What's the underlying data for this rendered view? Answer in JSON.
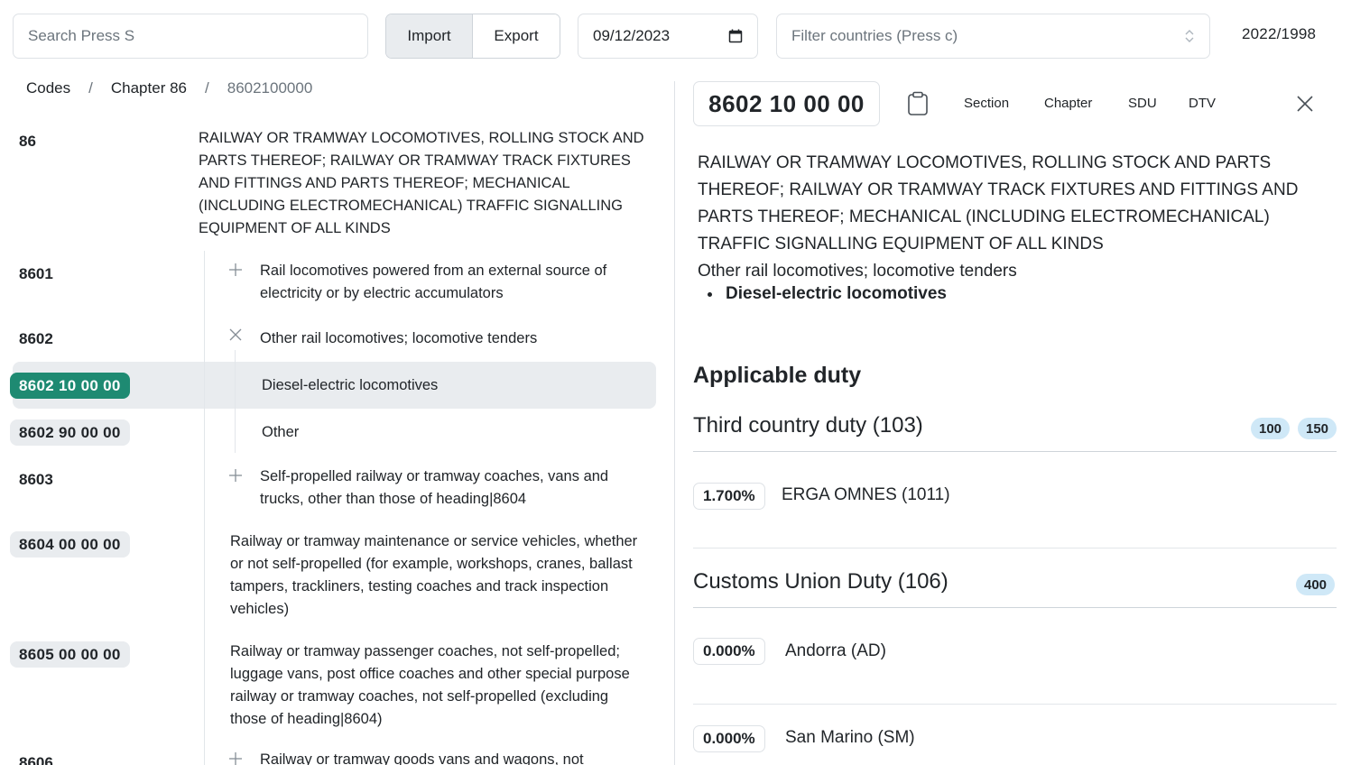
{
  "topbar": {
    "search_placeholder": "Search Press S",
    "import_label": "Import",
    "export_label": "Export",
    "date_value": "09/12/2023",
    "country_placeholder": "Filter countries (Press c)",
    "regulation": "2022/1998"
  },
  "breadcrumb": {
    "items": [
      "Codes",
      "Chapter 86",
      "8602100000"
    ],
    "separator": "/"
  },
  "tree": {
    "rows": [
      {
        "code": "86",
        "description": "RAILWAY OR TRAMWAY LOCOMOTIVES, ROLLING STOCK AND PARTS THEREOF; RAILWAY OR TRAMWAY TRACK FIXTURES AND FITTINGS AND PARTS THEREOF; MECHANICAL (INCLUDING ELECTROMECHANICAL) TRAFFIC SIGNALLING EQUIPMENT OF ALL KINDS"
      },
      {
        "code": "8601",
        "description": "Rail locomotives powered from an external source of electricity or by electric accumulators",
        "toggle": "expand"
      },
      {
        "code": "8602",
        "description": "Other rail locomotives; locomotive tenders",
        "toggle": "collapse"
      },
      {
        "code": "8602 10 00 00",
        "description": "Diesel-electric locomotives",
        "selected": true
      },
      {
        "code": "8602 90 00 00",
        "description": "Other"
      },
      {
        "code": "8603",
        "description": "Self-propelled railway or tramway coaches, vans and trucks, other than those of heading|8604",
        "toggle": "expand"
      },
      {
        "code": "8604 00 00 00",
        "description": "Railway or tramway maintenance or service vehicles, whether or not self-propelled (for example, workshops, cranes, ballast tampers, trackliners, testing coaches and track inspection vehicles)"
      },
      {
        "code": "8605 00 00 00",
        "description": "Railway or tramway passenger coaches, not self-propelled; luggage vans, post office coaches and other special purpose railway or tramway coaches, not self-propelled (excluding those of heading|8604)"
      },
      {
        "code": "8606",
        "description": "Railway or tramway goods vans and wagons, not",
        "toggle": "expand"
      }
    ]
  },
  "detail": {
    "code": "8602 10 00 00",
    "tabs": [
      "Section",
      "Chapter",
      "SDU",
      "DTV"
    ],
    "chapter_description": "RAILWAY OR TRAMWAY LOCOMOTIVES, ROLLING STOCK AND PARTS THEREOF; RAILWAY OR TRAMWAY TRACK FIXTURES AND FITTINGS AND PARTS THEREOF; MECHANICAL (INCLUDING ELECTROMECHANICAL) TRAFFIC SIGNALLING EQUIPMENT OF ALL KINDS",
    "heading_description": "Other rail locomotives; locomotive tenders",
    "item_description": "Diesel-electric locomotives",
    "applicable_duty_title": "Applicable duty",
    "sections": [
      {
        "title": "Third country duty (103)",
        "badges": [
          "100",
          "150"
        ],
        "rows": [
          {
            "rate": "1.700%",
            "geo": "ERGA OMNES (1011)"
          }
        ]
      },
      {
        "title": "Customs Union Duty (106)",
        "badges": [
          "400"
        ],
        "rows": [
          {
            "rate": "0.000%",
            "geo": "Andorra (AD)"
          },
          {
            "rate": "0.000%",
            "geo": "San Marino (SM)"
          }
        ]
      }
    ]
  },
  "colors": {
    "accent_selected": "#1e8a72",
    "badge_bg": "#cfe8f7",
    "pill_bg": "#e9ecef"
  }
}
